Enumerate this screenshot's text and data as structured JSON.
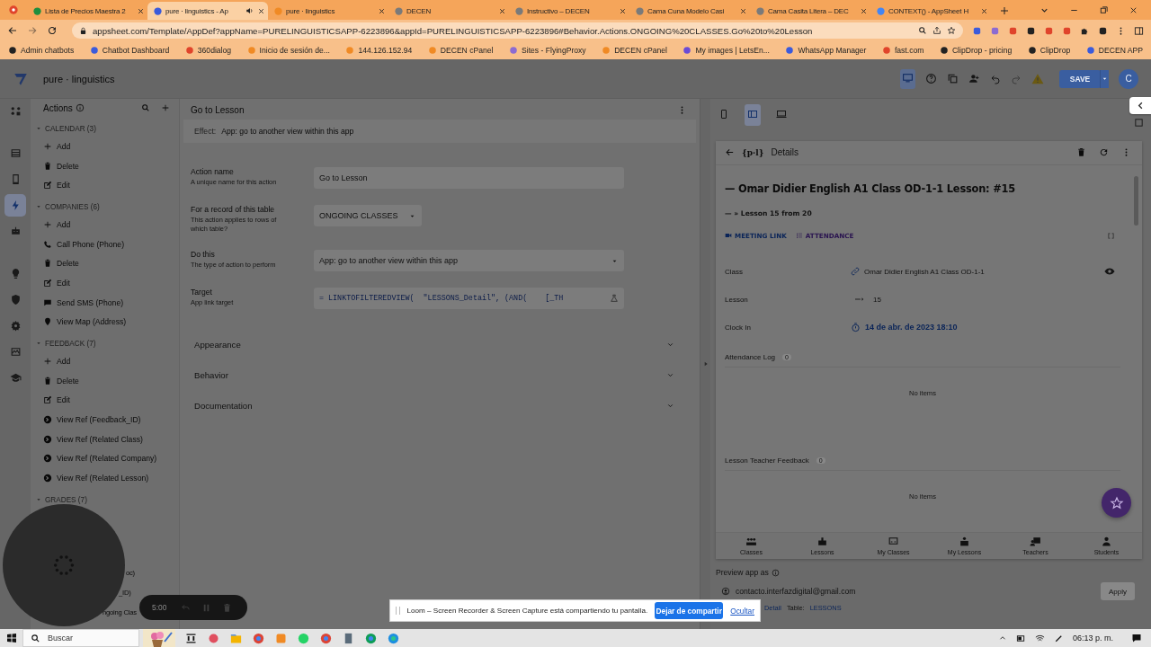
{
  "browser": {
    "tabs": [
      {
        "label": "Lista de Precios Maestra 2",
        "selected": false
      },
      {
        "label": "pure · linguistics - Ap",
        "selected": true
      },
      {
        "label": "pure · linguistics",
        "selected": false
      },
      {
        "label": "DECEN",
        "selected": false
      },
      {
        "label": "Instructivo – DECEN",
        "selected": false
      },
      {
        "label": "Cama Cuna Modelo Casi",
        "selected": false
      },
      {
        "label": "Cama Casita Litera – DEC",
        "selected": false
      },
      {
        "label": "CONTEXT() - AppSheet H",
        "selected": false
      }
    ],
    "url": "appsheet.com/Template/AppDef?appName=PURELINGUISTICSAPP-6223896&appId=PURELINGUISTICSAPP-6223896#Behavior.Actions.ONGOING%20CLASSES.Go%20to%20Lesson",
    "bookmarks": [
      "Admin chatbots",
      "Chatbot Dashboard",
      "360dialog",
      "Inicio de sesión de...",
      "144.126.152.94",
      "DECEN cPanel",
      "Sites - FlyingProxy",
      "DECEN cPanel",
      "My images | LetsEn...",
      "WhatsApp Manager",
      "fast.com",
      "ClipDrop - pricing",
      "ClipDrop",
      "DECEN APP"
    ]
  },
  "app": {
    "name": "pure · linguistics",
    "save_button": "SAVE",
    "avatar": "C"
  },
  "nav_rail": [
    {
      "selected": false
    },
    {
      "selected": false
    },
    {
      "selected": false
    },
    {
      "selected": true
    },
    {
      "selected": false
    },
    {
      "selected": false
    },
    {
      "selected": false
    },
    {
      "selected": false
    },
    {
      "selected": false
    },
    {
      "selected": false
    }
  ],
  "actions": {
    "title": "Actions",
    "groups": [
      {
        "label": "CALENDAR (3)",
        "expanded": true,
        "items": [
          {
            "kind": "add",
            "label": "Add"
          },
          {
            "kind": "delete",
            "label": "Delete"
          },
          {
            "kind": "edit",
            "label": "Edit"
          }
        ]
      },
      {
        "label": "COMPANIES (6)",
        "expanded": true,
        "items": [
          {
            "kind": "add",
            "label": "Add"
          },
          {
            "kind": "phone",
            "label": "Call Phone (Phone)"
          },
          {
            "kind": "delete",
            "label": "Delete"
          },
          {
            "kind": "edit",
            "label": "Edit"
          },
          {
            "kind": "sms",
            "label": "Send SMS (Phone)"
          },
          {
            "kind": "map",
            "label": "View Map (Address)"
          }
        ]
      },
      {
        "label": "FEEDBACK (7)",
        "expanded": true,
        "items": [
          {
            "kind": "add",
            "label": "Add"
          },
          {
            "kind": "delete",
            "label": "Delete"
          },
          {
            "kind": "edit",
            "label": "Edit"
          },
          {
            "kind": "ref",
            "label": "View Ref (Feedback_ID)"
          },
          {
            "kind": "ref",
            "label": "View Ref (Related Class)"
          },
          {
            "kind": "ref",
            "label": "View Ref (Related Company)"
          },
          {
            "kind": "ref",
            "label": "View Ref (Related Lesson)"
          }
        ]
      },
      {
        "label": "GRADES (7)",
        "expanded": true,
        "items": [
          {
            "kind": "partial",
            "label": "oc)"
          },
          {
            "kind": "partial",
            "label": "_ID)"
          },
          {
            "kind": "partial",
            "label": "ngoing Clas"
          }
        ]
      }
    ]
  },
  "editor": {
    "title": "Go to Lesson",
    "effect_label": "Effect:",
    "effect": "App: go to another view within this app",
    "fields": [
      {
        "kind": "text",
        "label": "Action name",
        "hint": "A unique name for this action",
        "value": "Go to Lesson"
      },
      {
        "kind": "select",
        "label": "For a record of this table",
        "hint": "This action applies to rows of which table?",
        "value": "ONGOING CLASSES"
      },
      {
        "kind": "wide-select",
        "label": "Do this",
        "hint": "The type of action to perform",
        "value": "App: go to another view within this app"
      },
      {
        "kind": "expression",
        "label": "Target",
        "hint": "App link target",
        "value": "= LINKTOFILTEREDVIEW(  \"LESSONS_Detail\", (AND(    [_TH"
      }
    ],
    "sections": [
      {
        "label": "Appearance",
        "expanded": false
      },
      {
        "label": "Behavior",
        "expanded": false
      },
      {
        "label": "Documentation",
        "expanded": false
      }
    ]
  },
  "preview": {
    "device_modes": [
      {
        "selected": false
      },
      {
        "selected": true
      },
      {
        "selected": false
      }
    ],
    "logo": "{p·l}",
    "view_title": "Details",
    "heading": "— Omar Didier English A1 Class OD-1-1 Lesson: #15",
    "subheading": "— » Lesson 15 from 20",
    "links": [
      "MEETING LINK",
      "ATTENDANCE"
    ],
    "fields": [
      {
        "kind": "ref",
        "label": "Class",
        "value": "Omar Didier English A1 Class OD-1-1"
      },
      {
        "kind": "progress",
        "label": "Lesson",
        "value": "15"
      },
      {
        "kind": "datetime",
        "label": "Clock In",
        "value": "14 de abr. de 2023 18:10"
      }
    ],
    "related": [
      {
        "label": "Attendance Log",
        "count": "0",
        "empty": "No items"
      },
      {
        "label": "Lesson Teacher Feedback",
        "count": "0",
        "empty": "No items"
      }
    ],
    "bottom_nav": [
      "Classes",
      "Lessons",
      "My Classes",
      "My Lessons",
      "Teachers",
      "Students"
    ],
    "preview_as_label": "Preview app as",
    "preview_email": "contacto.interfazdigital@gmail.com",
    "apply_button": "Apply",
    "view_link": "Detail",
    "table_label": "Table:",
    "table_value": "LESSONS"
  },
  "loom": {
    "timer": "5:00",
    "message": "Loom – Screen Recorder & Screen Capture está compartiendo tu pantalla.",
    "stop_button": "Dejar de compartir",
    "hide_link": "Ocultar"
  },
  "taskbar": {
    "search_placeholder": "Buscar",
    "clock": "06:13 p. m."
  }
}
